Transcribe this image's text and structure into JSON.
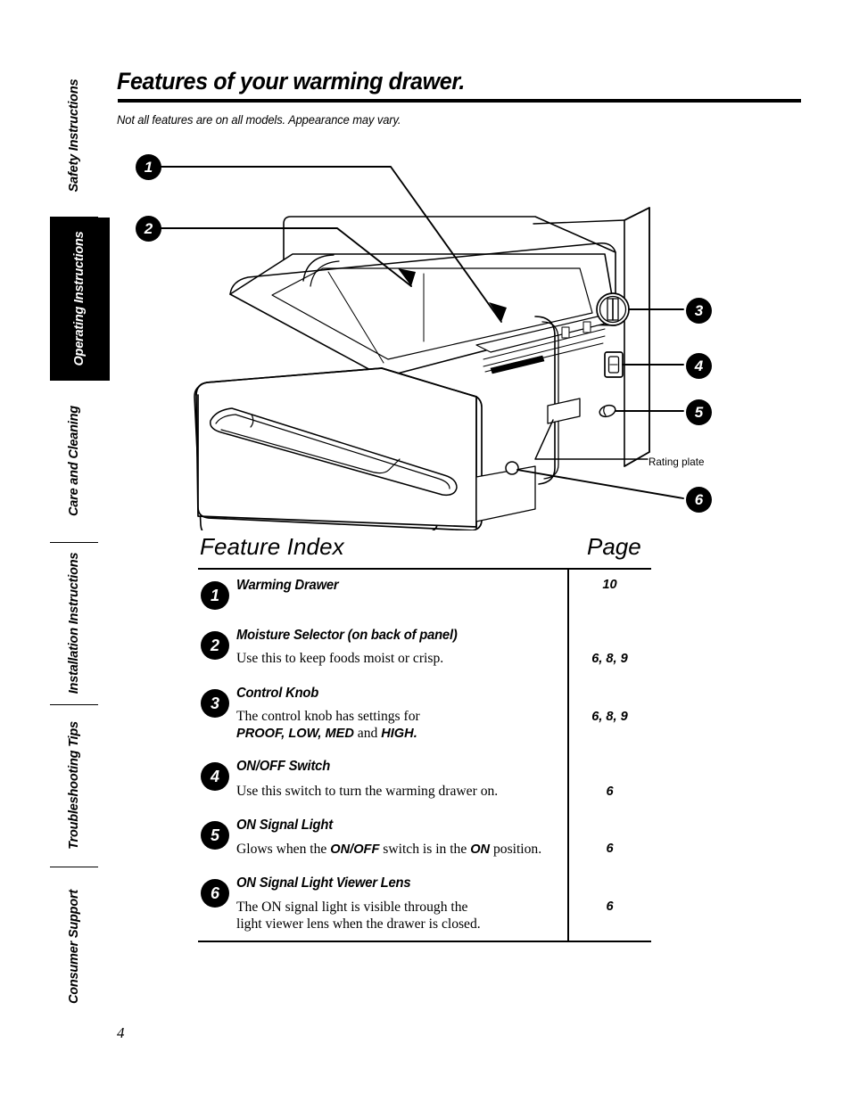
{
  "sidebar": {
    "items": [
      {
        "label": "Safety Instructions",
        "active": false
      },
      {
        "label": "Operating Instructions",
        "active": true
      },
      {
        "label": "Care and Cleaning",
        "active": false
      },
      {
        "label": "Installation Instructions",
        "active": false
      },
      {
        "label": "Troubleshooting Tips",
        "active": false
      },
      {
        "label": "Consumer Support",
        "active": false
      }
    ]
  },
  "header": {
    "title": "Features of your warming drawer.",
    "subtitle": "Not all features are on all models. Appearance may vary."
  },
  "illustration": {
    "callouts": [
      "1",
      "2",
      "3",
      "4",
      "5",
      "6"
    ],
    "rating_plate_label": "Rating plate",
    "parts": [
      "warming-drawer-front-panel",
      "drawer-handle",
      "drawer-interior-basket",
      "back-panel",
      "control-knob",
      "on-off-switch",
      "on-signal-light",
      "rating-plate",
      "signal-light-viewer-lens",
      "slide-rails"
    ]
  },
  "feature_index": {
    "head_left": "Feature Index",
    "head_right": "Page",
    "rows": [
      {
        "number": "1",
        "title": "Warming Drawer",
        "desc": "",
        "page": "10"
      },
      {
        "number": "2",
        "title": "Moisture Selector (on back of panel)",
        "desc": "Use this to keep foods moist or crisp.",
        "page": "6, 8, 9"
      },
      {
        "number": "3",
        "title": "Control Knob",
        "desc_line1": "The control knob has settings for",
        "desc_line2_bold_a": "PROOF, LOW, MED",
        "desc_line2_mid": " and ",
        "desc_line2_bold_b": "HIGH.",
        "page": "6, 8, 9"
      },
      {
        "number": "4",
        "title": "ON/OFF Switch",
        "desc": "Use this switch to turn the warming drawer on.",
        "page": "6"
      },
      {
        "number": "5",
        "title": "ON Signal Light",
        "desc_a": "Glows when the ",
        "desc_bold_a": "ON/OFF",
        "desc_b": " switch is in the ",
        "desc_bold_b": "ON",
        "desc_c": " position.",
        "page": "6"
      },
      {
        "number": "6",
        "title": "ON Signal Light Viewer Lens",
        "desc_line1": "The ON signal light is visible through the",
        "desc_line2": "light viewer lens when the drawer is closed.",
        "page": "6"
      }
    ]
  },
  "footer": {
    "page_number": "4"
  },
  "colors": {
    "ink": "#000000",
    "paper": "#ffffff"
  }
}
